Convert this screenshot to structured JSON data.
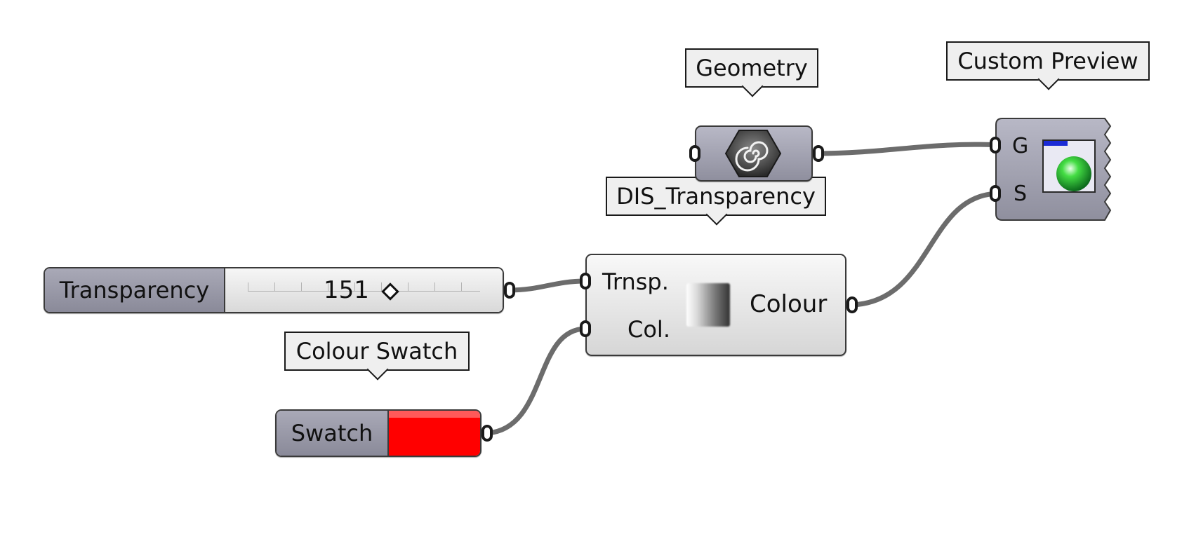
{
  "callouts": {
    "geometry": "Geometry",
    "custom_preview": "Custom Preview",
    "dis_transparency": "DIS_Transparency",
    "colour_swatch": "Colour Swatch"
  },
  "slider": {
    "name": "Transparency",
    "value": "151"
  },
  "swatch": {
    "name": "Swatch",
    "color": "#ff0000"
  },
  "transparency_component": {
    "inputs": [
      "Trnsp.",
      "Col."
    ],
    "output": "Colour"
  },
  "geometry_param": {
    "icon": "geometry-hexagon-spiral-icon"
  },
  "custom_preview": {
    "inputs": [
      "G",
      "S"
    ],
    "icon": "custom-preview-sphere-icon"
  },
  "colors": {
    "wire": "#6c6c6c",
    "param_dark": "#9797a6",
    "component_light": "#e6e6e6",
    "swatch_red": "#ff0000",
    "preview_sphere": "#33cc33"
  }
}
